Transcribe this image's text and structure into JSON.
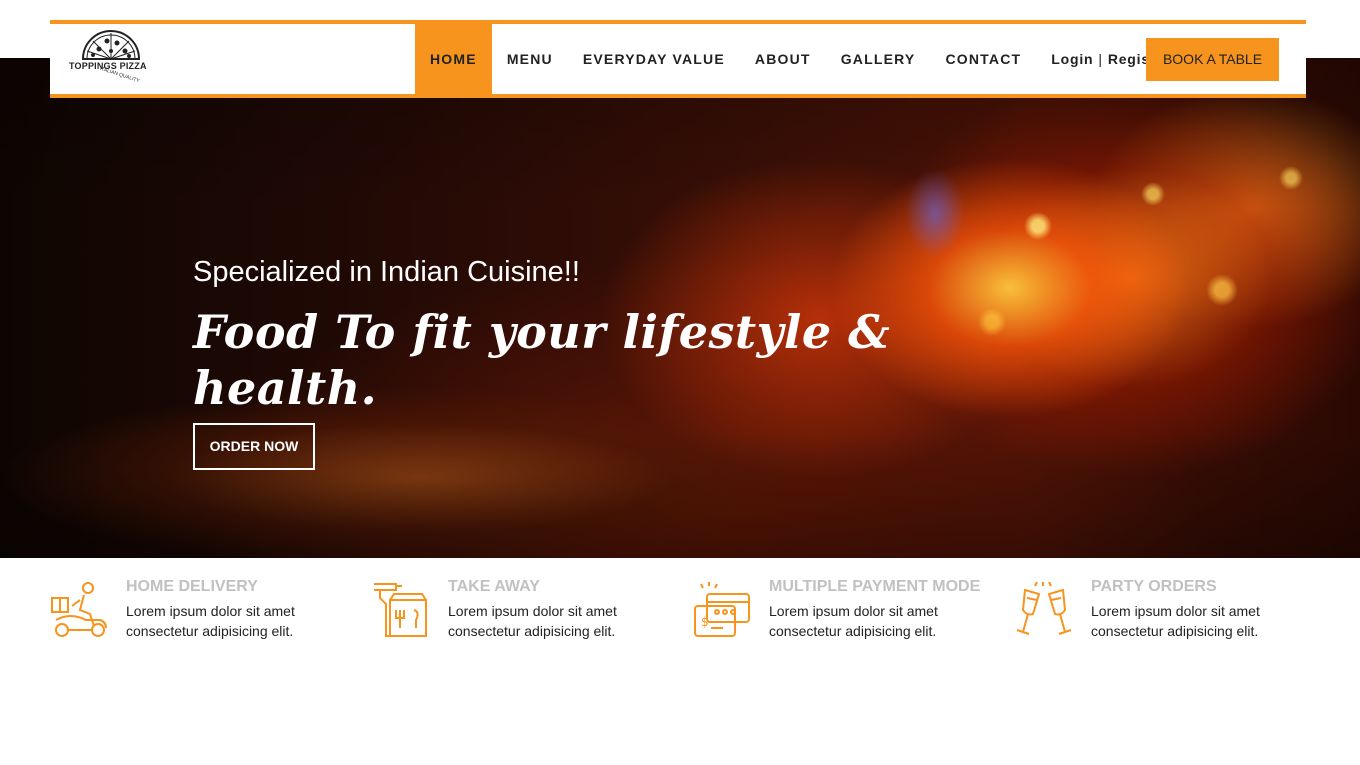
{
  "brand": {
    "name": "TOPPINGS PIZZA",
    "tagline": "ITALIAN QUALITY",
    "accent_color": "#f7941d"
  },
  "nav": {
    "items": [
      {
        "label": "HOME",
        "active": true
      },
      {
        "label": "MENU",
        "active": false
      },
      {
        "label": "EVERYDAY VALUE",
        "active": false
      },
      {
        "label": "ABOUT",
        "active": false
      },
      {
        "label": "GALLERY",
        "active": false
      },
      {
        "label": "CONTACT",
        "active": false
      }
    ],
    "login_label": "Login",
    "separator": "|",
    "register_label": "Register",
    "book_label": "BOOK A TABLE"
  },
  "hero": {
    "subtitle": "Specialized in Indian Cuisine!!",
    "title": "Food To fit your lifestyle & health.",
    "cta_label": "ORDER NOW"
  },
  "features": [
    {
      "icon": "delivery-scooter-icon",
      "title": "HOME DELIVERY",
      "desc": "Lorem ipsum dolor sit amet consectetur adipisicing elit."
    },
    {
      "icon": "takeaway-bag-icon",
      "title": "TAKE AWAY",
      "desc": "Lorem ipsum dolor sit amet consectetur adipisicing elit."
    },
    {
      "icon": "payment-card-icon",
      "title": "MULTIPLE PAYMENT MODE",
      "desc": "Lorem ipsum dolor sit amet consectetur adipisicing elit."
    },
    {
      "icon": "champagne-glasses-icon",
      "title": "PARTY ORDERS",
      "desc": "Lorem ipsum dolor sit amet consectetur adipisicing elit."
    }
  ]
}
